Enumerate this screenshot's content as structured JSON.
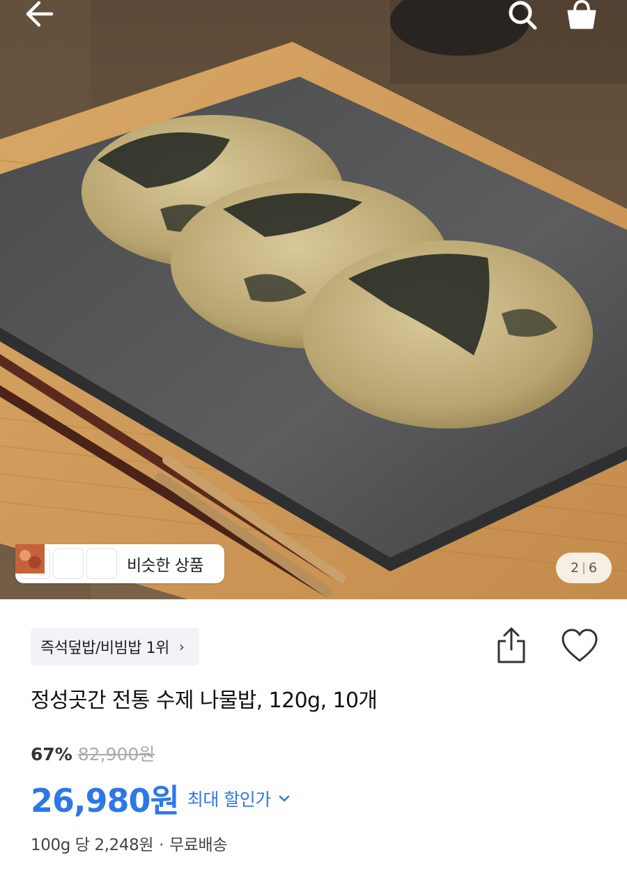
{
  "top_bar": {
    "back_icon": "arrow-left-icon",
    "search_icon": "search-icon",
    "cart_icon": "shopping-bag-icon"
  },
  "hero": {
    "image_description_icon": "product-photo",
    "similar_products": {
      "label": "비슷한 상품",
      "thumbnails": [
        "thumb-1",
        "thumb-2",
        "thumb-3"
      ]
    },
    "page_indicator": {
      "current": "2",
      "total": "6"
    }
  },
  "product": {
    "ranking_label": "즉석덮밥/비빔밥 1위",
    "title": "정성곳간 전통 수제 나물밥, 120g, 10개",
    "discount_rate": "67%",
    "original_price": "82,900원",
    "sale_price": "26,980원",
    "max_discount_label": "최대 할인가",
    "unit_price": "100g 당 2,248원",
    "shipping": "무료배송"
  },
  "colors": {
    "accent": "#2d78e6",
    "chip_bg": "#f1f3f6"
  }
}
